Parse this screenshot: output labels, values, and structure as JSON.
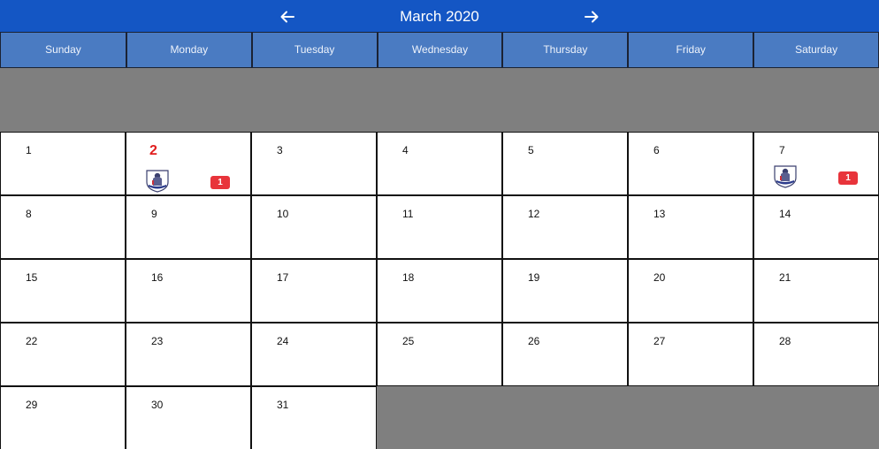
{
  "header": {
    "title": "March 2020",
    "prev_icon": "arrow-left-icon",
    "next_icon": "arrow-right-icon"
  },
  "weekdays": [
    "Sunday",
    "Monday",
    "Tuesday",
    "Wednesday",
    "Thursday",
    "Friday",
    "Saturday"
  ],
  "days": {
    "d1": "1",
    "d2": "2",
    "d3": "3",
    "d4": "4",
    "d5": "5",
    "d6": "6",
    "d7": "7",
    "d8": "8",
    "d9": "9",
    "d10": "10",
    "d11": "11",
    "d12": "12",
    "d13": "13",
    "d14": "14",
    "d15": "15",
    "d16": "16",
    "d17": "17",
    "d18": "18",
    "d19": "19",
    "d20": "20",
    "d21": "21",
    "d22": "22",
    "d23": "23",
    "d24": "24",
    "d25": "25",
    "d26": "26",
    "d27": "27",
    "d28": "28",
    "d29": "29",
    "d30": "30",
    "d31": "31"
  },
  "events": {
    "d2": {
      "count": "1",
      "icon": "premier-league-logo"
    },
    "d7": {
      "count": "1",
      "icon": "premier-league-logo"
    }
  },
  "colors": {
    "header_bg": "#1456c4",
    "weekday_bg": "#4a7bc2",
    "empty_bg": "#7f7f7f",
    "highlight_day": "#e11d1d",
    "badge": "#e8343b"
  }
}
